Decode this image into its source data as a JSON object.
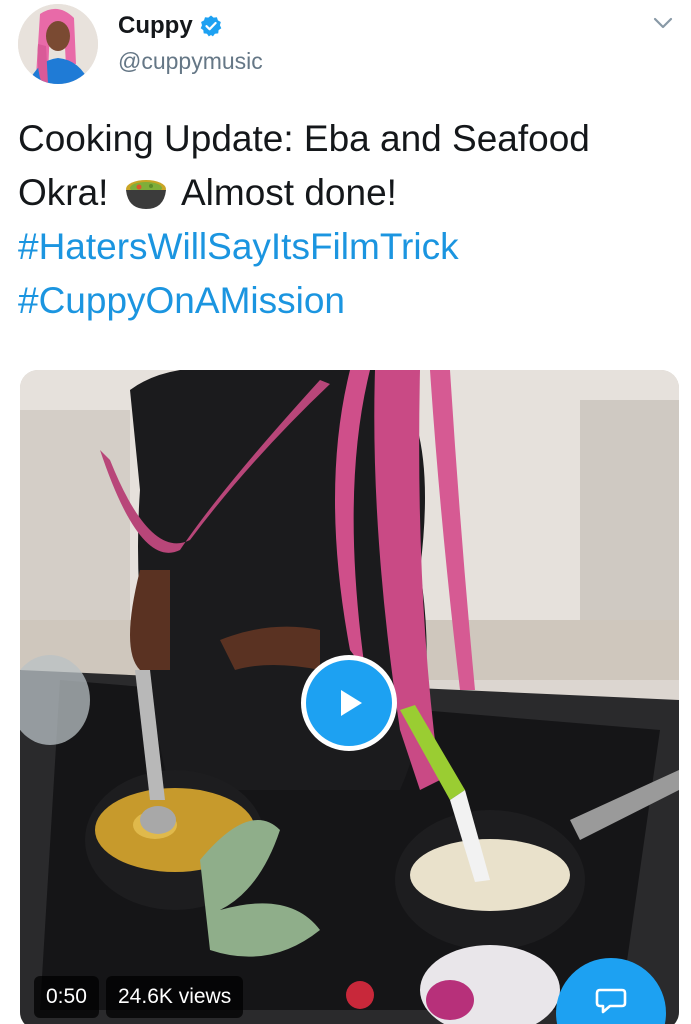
{
  "user": {
    "display_name": "Cuppy",
    "handle": "@cuppymusic",
    "verified_icon": "verified-badge-icon",
    "avatar_icon": "avatar"
  },
  "tweet": {
    "line1": "Cooking Update: Eba and Seafood",
    "line2_start": "Okra!",
    "emoji": "stew-bowl-emoji",
    "line2_end": "Almost done!",
    "hashtag1": "#HatersWillSayItsFilmTrick",
    "hashtag2": "#CuppyOnAMission"
  },
  "video": {
    "duration": "0:50",
    "views": "24.6K views"
  },
  "icons": {
    "menu": "chevron-down-icon",
    "play": "play-icon",
    "compose": "compose-reply-icon"
  },
  "colors": {
    "accent": "#1da1f2",
    "hashtag": "#1b95e0",
    "secondary_text": "#657786"
  }
}
